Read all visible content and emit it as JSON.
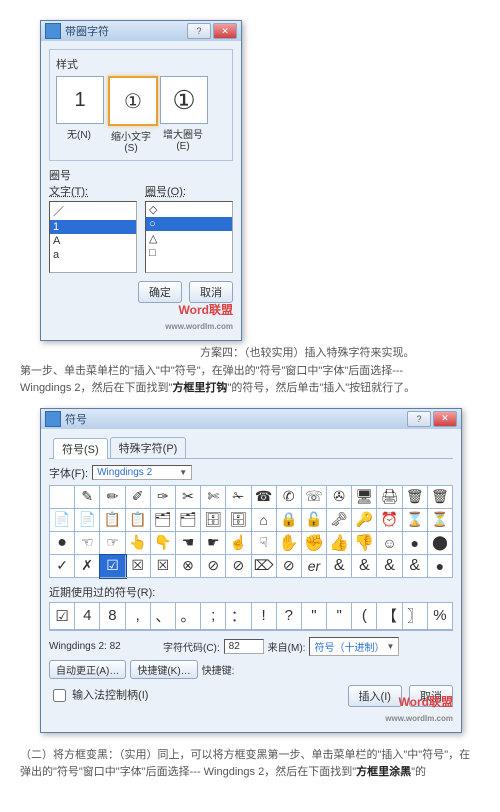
{
  "dialog1": {
    "title": "带圈字符",
    "style_label": "样式",
    "styles": [
      {
        "char": "1",
        "cap": "无(N)"
      },
      {
        "char": "①",
        "cap": "缩小文字(S)"
      },
      {
        "char": "①",
        "cap": "增大圈号(E)"
      }
    ],
    "ring_label": "圈号",
    "text_label": "文字(T):",
    "ring_col_label": "圈号(O):",
    "text_items": [
      "／",
      "1",
      "A",
      "a"
    ],
    "ring_items": [
      "◇",
      "○",
      "△",
      "□"
    ],
    "ok": "确定",
    "cancel": "取消",
    "watermark": "Word联盟",
    "wmurl": "www.wordlm.com"
  },
  "para1": "方案四：（也较实用）插入特殊字符来实现。",
  "para2a": "第一步、单击菜单栏的\"插入\"中\"符号\"，在弹出的\"符号\"窗口中\"字体\"后面选择---",
  "para2b": "Wingdings 2，然后在下面找到\"",
  "para2bold": "方框里打钩",
  "para2c": "\"的符号，然后单击\"插入\"按钮就行了。",
  "dialog2": {
    "title": "符号",
    "tab1": "符号(S)",
    "tab2": "特殊字符(P)",
    "font_label": "字体(F):",
    "font_value": "Wingdings 2",
    "recent_label": "近期使用过的符号(R):",
    "recent": [
      "☑",
      "4",
      "8",
      ",",
      "、",
      "。",
      ";",
      "：",
      "!",
      "?",
      "\"",
      "\"",
      "(",
      "【",
      "〗",
      "%"
    ],
    "fontname": "Wingdings 2: 82",
    "code_label": "字符代码(C):",
    "code_value": "82",
    "from_label": "来自(M):",
    "from_value": "符号（十进制）",
    "autocorrect": "自动更正(A)…",
    "shortcut": "快捷键(K)…",
    "shortcut_label": "快捷键:",
    "ime": "输入法控制柄(I)",
    "insert": "插入(I)",
    "cancel": "取消",
    "watermark": "Word联盟",
    "wmurl": "www.wordlm.com"
  },
  "para3a": "（二）将方框变黑：（实用）同上，可以将方框变黑第一步、单击菜单栏的\"插入\"中\"符号\"，在弹出的\"符号\"窗口中\"字体\"后面选择--- Wingdings 2，然后在下面找到\"",
  "para3bold": "方框里涂黑",
  "para3b": "\"的"
}
